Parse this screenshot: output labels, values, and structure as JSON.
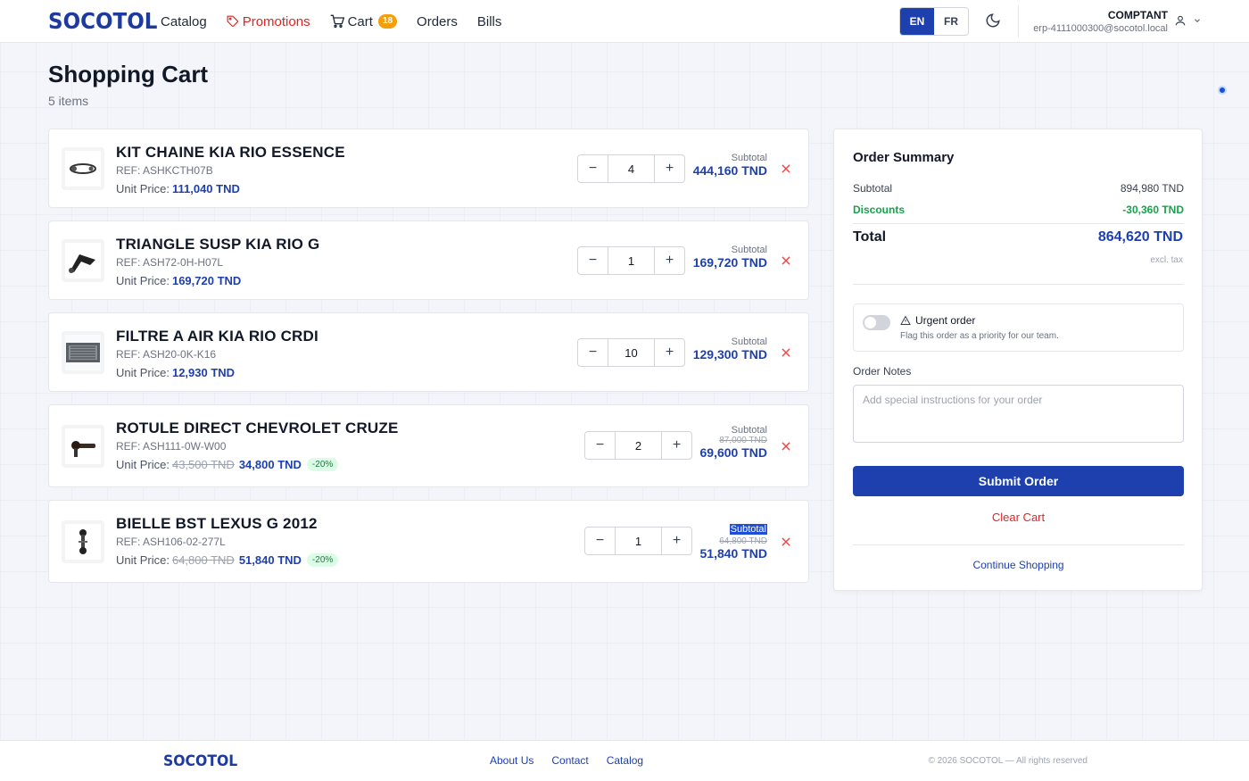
{
  "header": {
    "logo": "SOCOTOL",
    "nav": {
      "catalog": "Catalog",
      "promotions": "Promotions",
      "cart": "Cart",
      "cart_count": "18",
      "orders": "Orders",
      "bills": "Bills"
    },
    "lang_en": "EN",
    "lang_fr": "FR",
    "user_name": "COMPTANT",
    "user_email": "erp-4111000300@socotol.local"
  },
  "page": {
    "title": "Shopping Cart",
    "item_count": "5 items"
  },
  "cart_items": [
    {
      "name": "KIT CHAINE KIA RIO ESSENCE",
      "ref": "REF: ASHKCTH07B",
      "unit_label": "Unit Price:",
      "unit_price": "111,040 TND",
      "unit_old_price": "",
      "discount": "",
      "qty": "4",
      "subtotal_label": "Subtotal",
      "subtotal_old": "",
      "subtotal": "444,160 TND"
    },
    {
      "name": "TRIANGLE SUSP KIA RIO G",
      "ref": "REF: ASH72-0H-H07L",
      "unit_label": "Unit Price:",
      "unit_price": "169,720 TND",
      "unit_old_price": "",
      "discount": "",
      "qty": "1",
      "subtotal_label": "Subtotal",
      "subtotal_old": "",
      "subtotal": "169,720 TND"
    },
    {
      "name": "FILTRE A AIR KIA RIO CRDI",
      "ref": "REF: ASH20-0K-K16",
      "unit_label": "Unit Price:",
      "unit_price": "12,930 TND",
      "unit_old_price": "",
      "discount": "",
      "qty": "10",
      "subtotal_label": "Subtotal",
      "subtotal_old": "",
      "subtotal": "129,300 TND"
    },
    {
      "name": "ROTULE DIRECT CHEVROLET CRUZE",
      "ref": "REF: ASH111-0W-W00",
      "unit_label": "Unit Price:",
      "unit_price": "34,800 TND",
      "unit_old_price": "43,500 TND",
      "discount": "-20%",
      "qty": "2",
      "subtotal_label": "Subtotal",
      "subtotal_old": "87,000 TND",
      "subtotal": "69,600 TND"
    },
    {
      "name": "BIELLE BST LEXUS G 2012",
      "ref": "REF: ASH106-02-277L",
      "unit_label": "Unit Price:",
      "unit_price": "51,840 TND",
      "unit_old_price": "64,800 TND",
      "discount": "-20%",
      "qty": "1",
      "subtotal_label": "Subtotal",
      "subtotal_old": "64,800 TND",
      "subtotal": "51,840 TND"
    }
  ],
  "summary": {
    "title": "Order Summary",
    "subtotal_label": "Subtotal",
    "subtotal_value": "894,980 TND",
    "discounts_label": "Discounts",
    "discounts_value": "-30,360 TND",
    "total_label": "Total",
    "total_value": "864,620 TND",
    "excl_tax": "excl. tax",
    "urgent_title": "Urgent order",
    "urgent_desc": "Flag this order as a priority for our team.",
    "notes_label": "Order Notes",
    "notes_placeholder": "Add special instructions for your order",
    "submit": "Submit Order",
    "clear": "Clear Cart",
    "continue": "Continue Shopping"
  },
  "footer": {
    "logo": "SOCOTOL",
    "about": "About Us",
    "contact": "Contact",
    "catalog": "Catalog",
    "copyright": "© 2026 SOCOTOL — All rights reserved"
  },
  "colors": {
    "brand": "#1e3a9e",
    "accent": "#1e40af",
    "danger": "#dc2626",
    "success": "#16a34a",
    "badge": "#f59e0b"
  }
}
